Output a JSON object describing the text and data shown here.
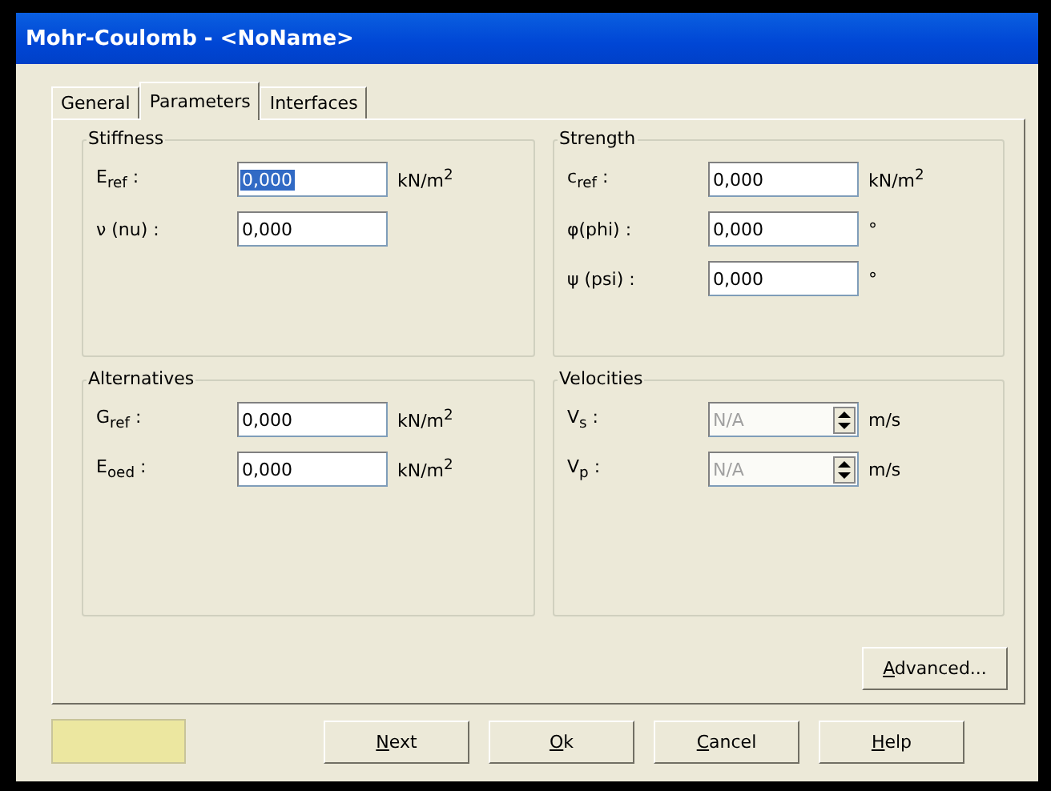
{
  "window": {
    "title": "Mohr-Coulomb - <NoName>"
  },
  "tabs": [
    {
      "label": "General",
      "selected": false
    },
    {
      "label": "Parameters",
      "selected": true
    },
    {
      "label": "Interfaces",
      "selected": false
    }
  ],
  "groups": [
    {
      "title": "Stiffness",
      "rows": [
        {
          "label": "E$_{ref}$ :",
          "value": "0,000",
          "unit": "kN/m$^{2}$",
          "kind": "text",
          "selected": true,
          "disabled": false
        },
        {
          "label": "ν (nu) :",
          "value": "0,000",
          "kind": "text",
          "selected": false,
          "disabled": false
        }
      ]
    },
    {
      "title": "Strength",
      "rows": [
        {
          "label": "c$_{ref}$ :",
          "value": "0,000",
          "unit": "kN/m$^{2}$",
          "kind": "text",
          "selected": false,
          "disabled": false
        },
        {
          "label": "φ(phi) :",
          "value": "0,000",
          "unit": "°",
          "kind": "text",
          "selected": false,
          "disabled": false
        },
        {
          "label": "ψ (psi) :",
          "value": "0,000",
          "unit": "°",
          "kind": "text",
          "selected": false,
          "disabled": false
        }
      ]
    },
    {
      "title": "Alternatives",
      "rows": [
        {
          "label": "G$_{ref}$ :",
          "value": "0,000",
          "unit": "kN/m$^{2}$",
          "kind": "text",
          "selected": false,
          "disabled": false
        },
        {
          "label": "E$_{oed}$ :",
          "value": "0,000",
          "unit": "kN/m$^{2}$",
          "kind": "text",
          "selected": false,
          "disabled": false
        }
      ]
    },
    {
      "title": "Velocities",
      "rows": [
        {
          "label": "V$_{s}$ :",
          "value": "N/A",
          "unit": "m/s",
          "kind": "spin",
          "selected": false,
          "disabled": true
        },
        {
          "label": "V$_{p}$ :",
          "value": "N/A",
          "unit": "m/s",
          "kind": "spin",
          "selected": false,
          "disabled": true
        }
      ]
    }
  ],
  "advanced_button": {
    "label": "Advanced..."
  },
  "buttons": [
    {
      "label": "Next"
    },
    {
      "label": "Ok"
    },
    {
      "label": "Cancel"
    },
    {
      "label": "Help"
    }
  ]
}
